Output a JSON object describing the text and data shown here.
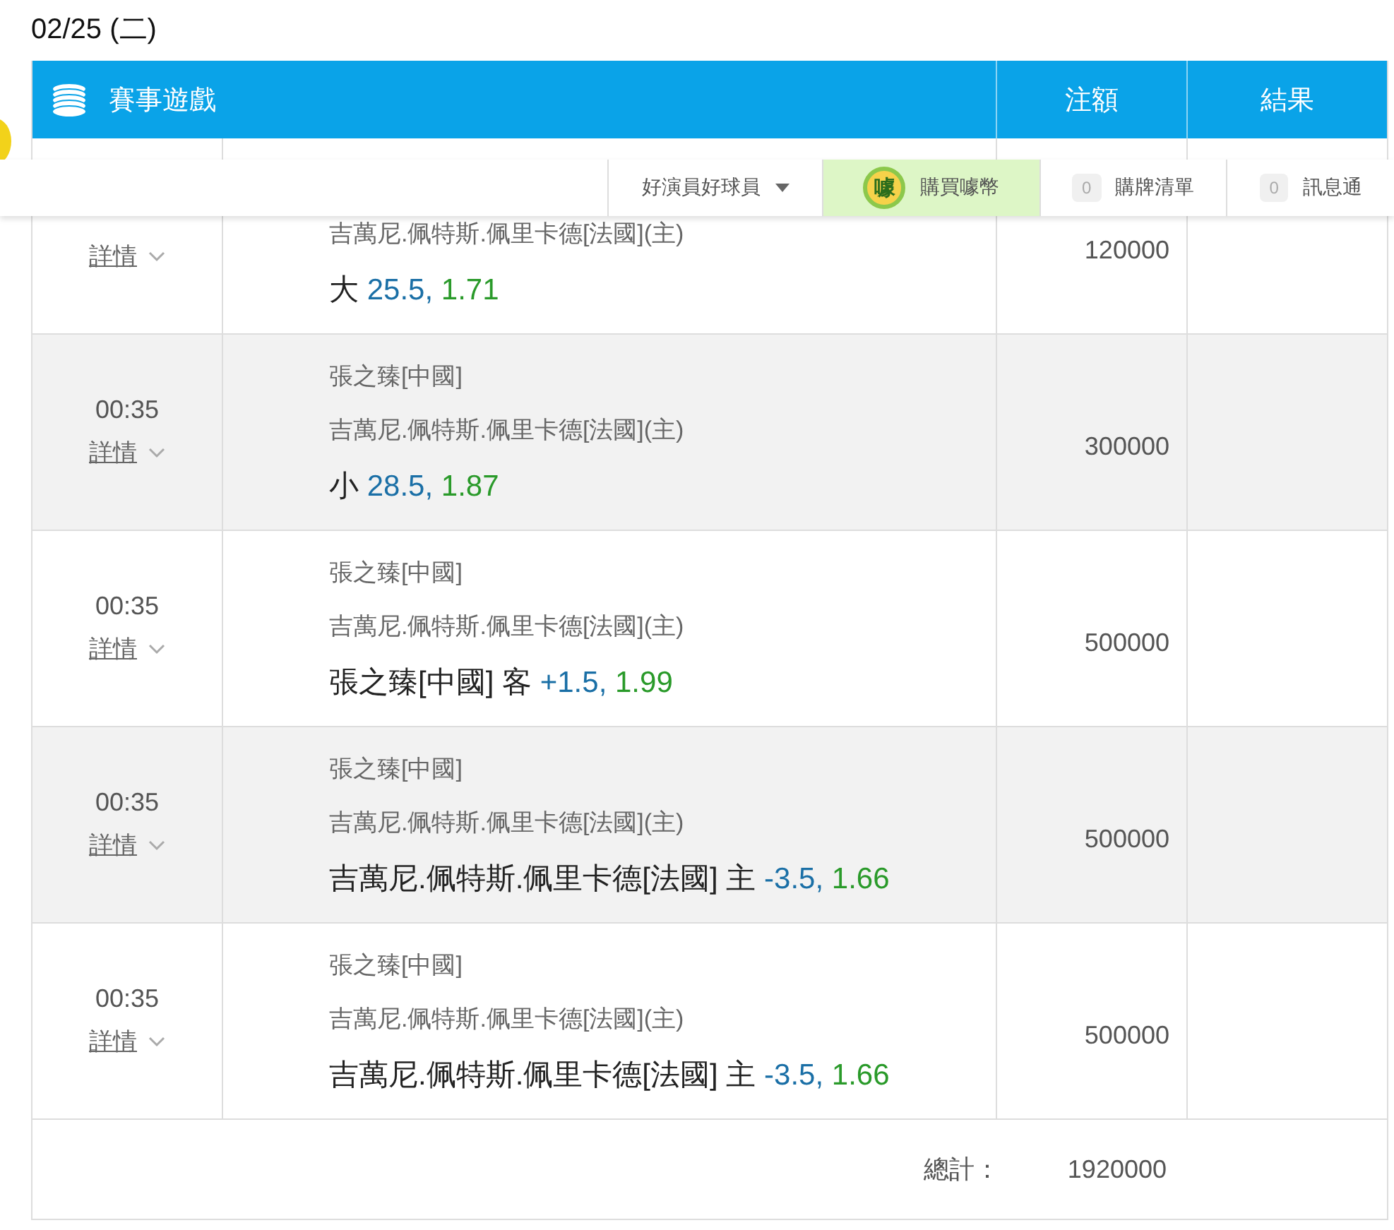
{
  "date": "02/25 (二)",
  "table": {
    "title": "賽事遊戲",
    "columns": [
      "注額",
      "結果"
    ],
    "rows": [
      {
        "detail_link": "詳情",
        "home": "吉萬尼.佩特斯.佩里卡德[法國](主)",
        "pick": {
          "label": "大",
          "line": "25.5,",
          "odds": "1.71"
        },
        "amount": "120000"
      },
      {
        "time": "00:35",
        "detail_link": "詳情",
        "away": "張之臻[中國]",
        "home": "吉萬尼.佩特斯.佩里卡德[法國](主)",
        "pick": {
          "label": "小",
          "line": "28.5,",
          "odds": "1.87"
        },
        "amount": "300000"
      },
      {
        "time": "00:35",
        "detail_link": "詳情",
        "away": "張之臻[中國]",
        "home": "吉萬尼.佩特斯.佩里卡德[法國](主)",
        "pick": {
          "label": "張之臻[中國] 客",
          "line": "+1.5,",
          "odds": "1.99"
        },
        "amount": "500000"
      },
      {
        "time": "00:35",
        "detail_link": "詳情",
        "away": "張之臻[中國]",
        "home": "吉萬尼.佩特斯.佩里卡德[法國](主)",
        "pick": {
          "label": "吉萬尼.佩特斯.佩里卡德[法國] 主",
          "line": "-3.5,",
          "odds": "1.66"
        },
        "amount": "500000"
      },
      {
        "time": "00:35",
        "detail_link": "詳情",
        "away": "張之臻[中國]",
        "home": "吉萬尼.佩特斯.佩里卡德[法國](主)",
        "pick": {
          "label": "吉萬尼.佩特斯.佩里卡德[法國] 主",
          "line": "-3.5,",
          "odds": "1.66"
        },
        "amount": "500000"
      }
    ],
    "total_label": "總計：",
    "total": "1920000"
  },
  "top_bar": {
    "items": [
      {
        "kind": "dropdown",
        "label": "好演員好球員"
      },
      {
        "kind": "promo",
        "label": "購買噱幣",
        "logo_text": "噱"
      },
      {
        "kind": "counter",
        "count": "0",
        "label": "購牌清單"
      },
      {
        "kind": "counter",
        "count": "0",
        "label": "訊息通"
      }
    ]
  }
}
